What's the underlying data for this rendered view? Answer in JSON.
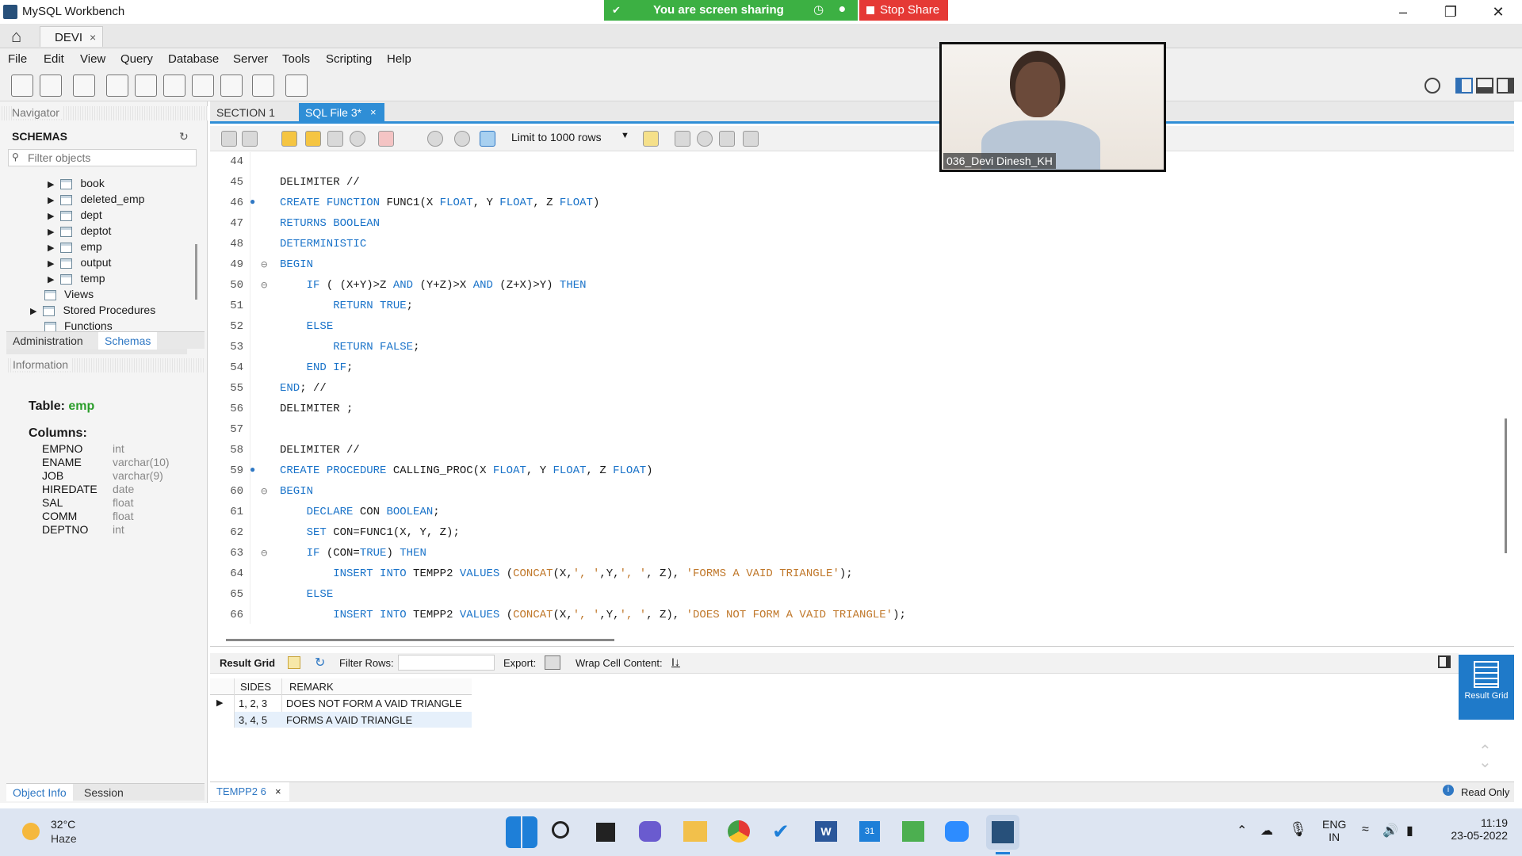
{
  "window": {
    "title": "MySQL Workbench"
  },
  "share": {
    "text": "You are screen sharing",
    "stop": "Stop Share"
  },
  "conn_tab": {
    "label": "DEVI",
    "close": "×"
  },
  "menu": [
    "File",
    "Edit",
    "View",
    "Query",
    "Database",
    "Server",
    "Tools",
    "Scripting",
    "Help"
  ],
  "navigator": {
    "header": "Navigator",
    "schemas": "SCHEMAS",
    "filter_placeholder": "Filter objects",
    "tables": [
      "book",
      "deleted_emp",
      "dept",
      "deptot",
      "emp",
      "output",
      "temp"
    ],
    "folders": [
      "Views",
      "Stored Procedures",
      "Functions"
    ],
    "tabs": [
      "Administration",
      "Schemas"
    ]
  },
  "information": {
    "header": "Information",
    "table_label": "Table:",
    "table_name": "emp",
    "columns_label": "Columns:",
    "columns": [
      {
        "name": "EMPNO",
        "type": "int"
      },
      {
        "name": "ENAME",
        "type": "varchar(10)"
      },
      {
        "name": "JOB",
        "type": "varchar(9)"
      },
      {
        "name": "HIREDATE",
        "type": "date"
      },
      {
        "name": "SAL",
        "type": "float"
      },
      {
        "name": "COMM",
        "type": "float"
      },
      {
        "name": "DEPTNO",
        "type": "int"
      }
    ],
    "bottom_tabs": [
      "Object Info",
      "Session"
    ]
  },
  "editor": {
    "tabs": [
      "SECTION 1",
      "SQL File 3*"
    ],
    "tab_close": "×",
    "limit": "Limit to 1000 rows",
    "lines": [
      {
        "n": "44",
        "code": ""
      },
      {
        "n": "45",
        "code": "DELIMITER //"
      },
      {
        "n": "46",
        "code": "CREATE FUNCTION FUNC1(X FLOAT, Y FLOAT, Z FLOAT)"
      },
      {
        "n": "47",
        "code": "RETURNS BOOLEAN"
      },
      {
        "n": "48",
        "code": "DETERMINISTIC"
      },
      {
        "n": "49",
        "code": "BEGIN"
      },
      {
        "n": "50",
        "code": "    IF ( (X+Y)>Z AND (Y+Z)>X AND (Z+X)>Y) THEN"
      },
      {
        "n": "51",
        "code": "        RETURN TRUE;"
      },
      {
        "n": "52",
        "code": "    ELSE"
      },
      {
        "n": "53",
        "code": "        RETURN FALSE;"
      },
      {
        "n": "54",
        "code": "    END IF;"
      },
      {
        "n": "55",
        "code": "END; //"
      },
      {
        "n": "56",
        "code": "DELIMITER ;"
      },
      {
        "n": "57",
        "code": ""
      },
      {
        "n": "58",
        "code": "DELIMITER //"
      },
      {
        "n": "59",
        "code": "CREATE PROCEDURE CALLING_PROC(X FLOAT, Y FLOAT, Z FLOAT)"
      },
      {
        "n": "60",
        "code": "BEGIN"
      },
      {
        "n": "61",
        "code": "    DECLARE CON BOOLEAN;"
      },
      {
        "n": "62",
        "code": "    SET CON=FUNC1(X, Y, Z);"
      },
      {
        "n": "63",
        "code": "    IF (CON=TRUE) THEN"
      },
      {
        "n": "64",
        "code": "        INSERT INTO TEMPP2 VALUES (CONCAT(X,', ',Y,', ', Z), 'FORMS A VAID TRIANGLE');"
      },
      {
        "n": "65",
        "code": "    ELSE"
      },
      {
        "n": "66",
        "code": "        INSERT INTO TEMPP2 VALUES (CONCAT(X,', ',Y,', ', Z), 'DOES NOT FORM A VAID TRIANGLE');"
      }
    ]
  },
  "results": {
    "result_grid": "Result Grid",
    "filter_rows": "Filter Rows:",
    "export": "Export:",
    "wrap": "Wrap Cell Content:",
    "side_label": "Result Grid",
    "columns": [
      "SIDES",
      "REMARK"
    ],
    "rows": [
      [
        "1, 2, 3",
        "DOES NOT FORM A VAID TRIANGLE"
      ],
      [
        "3, 4, 5",
        "FORMS A VAID TRIANGLE"
      ]
    ],
    "tab": "TEMPP2 6",
    "read_only": "Read Only"
  },
  "webcam": {
    "name": "036_Devi Dinesh_KH"
  },
  "taskbar": {
    "temp": "32°C",
    "weather": "Haze",
    "lang1": "ENG",
    "lang2": "IN",
    "time": "11:19",
    "date": "23-05-2022"
  }
}
